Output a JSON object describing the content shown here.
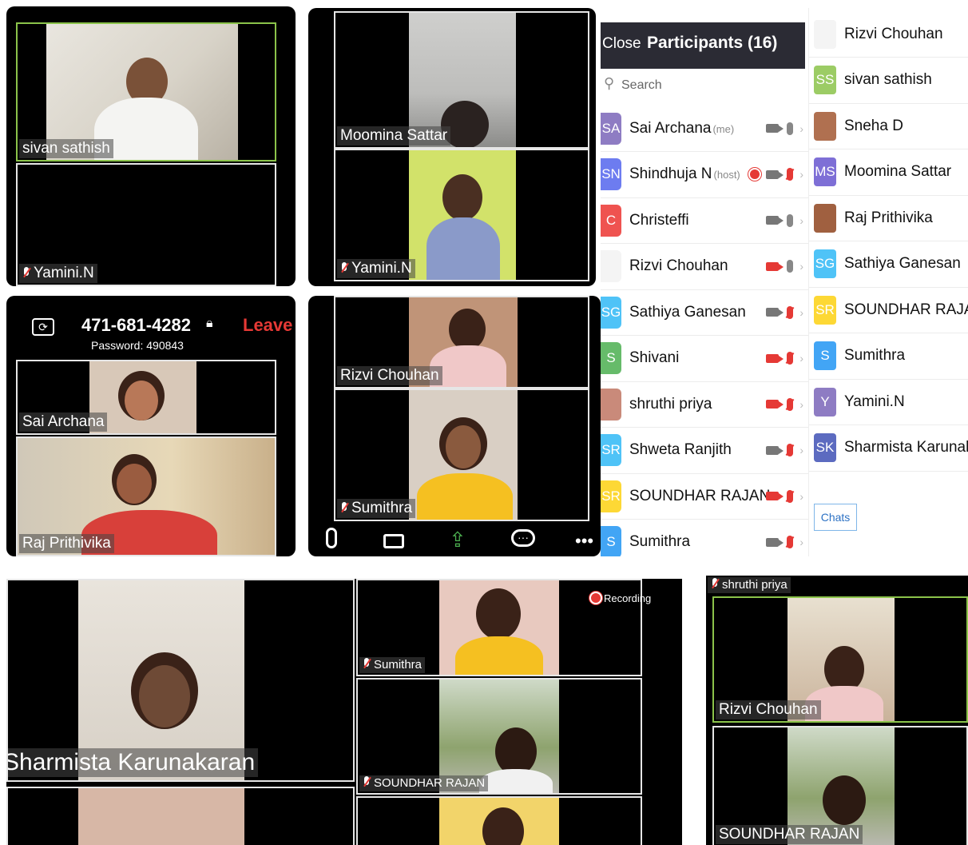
{
  "screen1": {
    "tile_top_name": "sivan sathish",
    "tile_bottom_name": "Yamini.N"
  },
  "screen2": {
    "tile_top_name": "Moomina Sattar",
    "tile_bottom_name": "Yamini.N"
  },
  "screen3": {
    "meeting_id": "471-681-4282",
    "leave_label": "Leave",
    "password": "Password: 490843",
    "tile_top_name": "Sai Archana",
    "tile_bottom_name": "Raj Prithivika"
  },
  "screen4": {
    "tile_top_name": "Rizvi Chouhan",
    "tile_bottom_name": "Sumithra"
  },
  "participants": {
    "close_label": "Close",
    "title": "Participants (16)",
    "search_placeholder": "Search",
    "left_list": [
      {
        "initials": "SA",
        "name": "Sai Archana",
        "tag": "(me)",
        "color": "#8e7cc3",
        "cam": "on",
        "mic": "on"
      },
      {
        "initials": "SN",
        "name": "Shindhuja N",
        "tag": "(host)",
        "color": "#6d7cf0",
        "cam": "on",
        "mic": "off",
        "recording": true
      },
      {
        "initials": "C",
        "name": "Christeffi",
        "tag": "",
        "color": "#ef5350",
        "cam": "on",
        "mic": "on"
      },
      {
        "initials": "",
        "name": "Rizvi Chouhan",
        "tag": "",
        "color": "#f4f4f4",
        "cam": "off",
        "mic": "on"
      },
      {
        "initials": "SG",
        "name": "Sathiya Ganesan",
        "tag": "",
        "color": "#4fc3f7",
        "cam": "on",
        "mic": "off"
      },
      {
        "initials": "S",
        "name": "Shivani",
        "tag": "",
        "color": "#66bb6a",
        "cam": "off",
        "mic": "off"
      },
      {
        "initials": "",
        "name": "shruthi priya",
        "tag": "",
        "color": "#c98a7a",
        "cam": "off",
        "mic": "off"
      },
      {
        "initials": "SR",
        "name": "Shweta Ranjith",
        "tag": "",
        "color": "#4fc3f7",
        "cam": "on",
        "mic": "off"
      },
      {
        "initials": "SR",
        "name": "SOUNDHAR RAJAN",
        "tag": "",
        "color": "#fdd835",
        "cam": "off",
        "mic": "off"
      },
      {
        "initials": "S",
        "name": "Sumithra",
        "tag": "",
        "color": "#42a5f5",
        "cam": "on",
        "mic": "off"
      }
    ],
    "right_list": [
      {
        "initials": "",
        "name": "Rizvi Chouhan",
        "color": "#f4f4f4"
      },
      {
        "initials": "SS",
        "name": "sivan sathish",
        "color": "#9ccc65"
      },
      {
        "initials": "",
        "name": "Sneha D",
        "color": "#b07050"
      },
      {
        "initials": "MS",
        "name": "Moomina Sattar",
        "color": "#7e6fd6"
      },
      {
        "initials": "",
        "name": "Raj Prithivika",
        "color": "#a06040"
      },
      {
        "initials": "SG",
        "name": "Sathiya Ganesan",
        "color": "#4fc3f7"
      },
      {
        "initials": "SR",
        "name": "SOUNDHAR RAJAN",
        "color": "#fdd835"
      },
      {
        "initials": "S",
        "name": "Sumithra",
        "color": "#42a5f5"
      },
      {
        "initials": "Y",
        "name": "Yamini.N",
        "color": "#8e7cc3"
      },
      {
        "initials": "SK",
        "name": "Sharmista Karunaka...",
        "color": "#5c6bc0"
      }
    ],
    "chats_label": "Chats"
  },
  "bottom": {
    "left_tile_name": "Sharmista Karunakaran",
    "mid_tile1_name": "Sumithra",
    "mid_tile2_name": "SOUNDHAR RAJAN",
    "recording_label": "Recording",
    "right_top_name": "shruthi priya",
    "right_tile1_name": "Rizvi Chouhan",
    "right_tile2_name": "SOUNDHAR RAJAN"
  },
  "colors": {
    "active_border": "#8bc34a",
    "leave_red": "#e53935",
    "toolbar_green": "#4caf50"
  }
}
